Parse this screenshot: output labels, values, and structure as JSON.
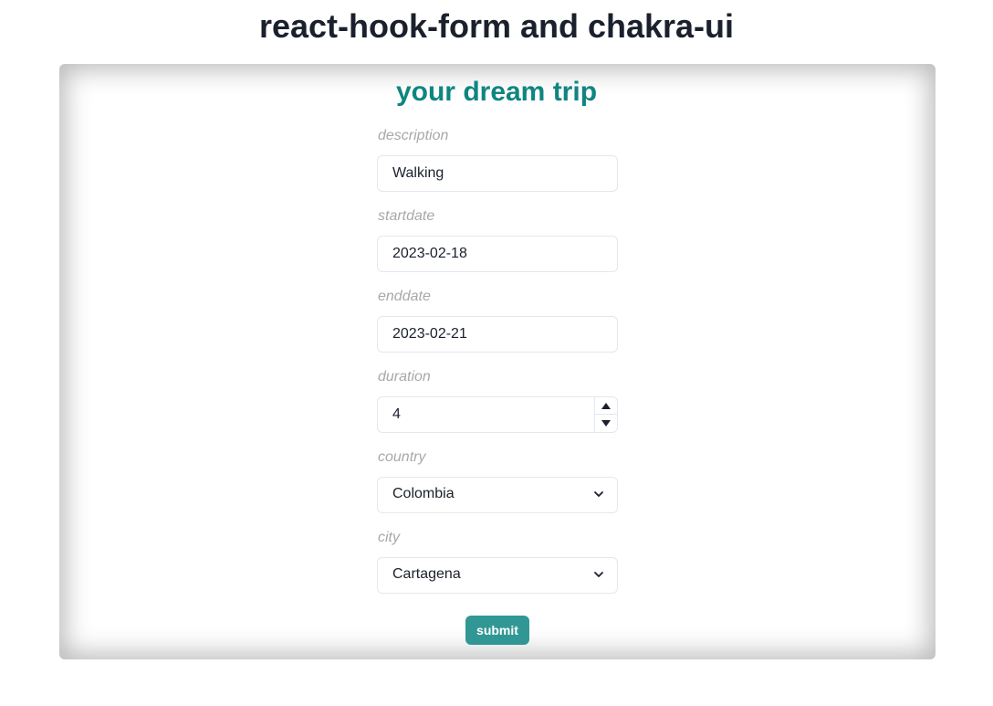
{
  "header": {
    "title": "react-hook-form and chakra-ui"
  },
  "form": {
    "title": "your dream trip",
    "fields": {
      "description": {
        "label": "description",
        "value": "Walking"
      },
      "startdate": {
        "label": "startdate",
        "value": "2023-02-18"
      },
      "enddate": {
        "label": "enddate",
        "value": "2023-02-21"
      },
      "duration": {
        "label": "duration",
        "value": "4"
      },
      "country": {
        "label": "country",
        "value": "Colombia"
      },
      "city": {
        "label": "city",
        "value": "Cartagena"
      }
    },
    "submit_label": "submit"
  },
  "colors": {
    "accent": "#0f8580",
    "button": "#319795",
    "label": "#a8a8a8",
    "text": "#1a202c"
  },
  "icons": {
    "stepper_up": "triangle-up-icon",
    "stepper_down": "triangle-down-icon",
    "select_arrow": "chevron-down-icon"
  }
}
